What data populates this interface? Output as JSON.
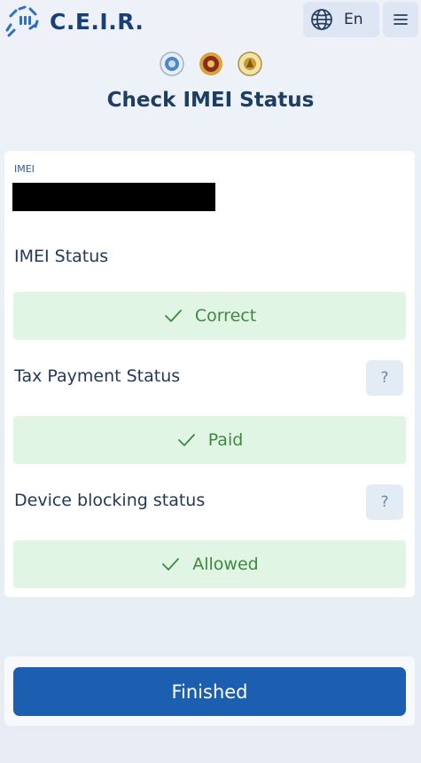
{
  "header": {
    "logo_text": "C.E.I.R.",
    "language": "En"
  },
  "page": {
    "title": "Check IMEI Status"
  },
  "imei": {
    "label": "IMEI",
    "value": "REDACTED"
  },
  "imei_status": {
    "title": "IMEI Status",
    "value": "Correct"
  },
  "tax_status": {
    "title": "Tax Payment Status",
    "value": "Paid",
    "help": "?"
  },
  "blocking_status": {
    "title": "Device blocking status",
    "value": "Allowed",
    "help": "?"
  },
  "footer": {
    "finish_label": "Finished"
  },
  "colors": {
    "primary": "#1c5fb0",
    "success_bg": "#e1f5e5",
    "success_text": "#3d8a3f",
    "title": "#1d3d63"
  },
  "icons": [
    "logo-icon",
    "globe-icon",
    "menu-icon",
    "seal-icon",
    "check-icon",
    "help-icon"
  ]
}
